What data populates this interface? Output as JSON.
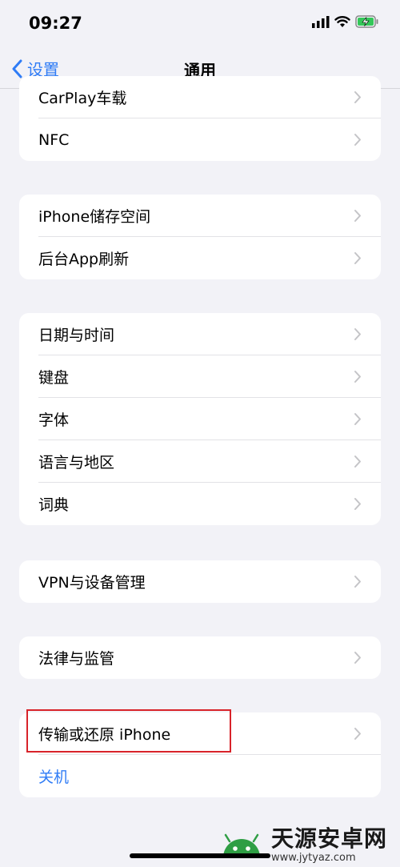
{
  "status": {
    "time": "09:27"
  },
  "nav": {
    "back_label": "设置",
    "title": "通用"
  },
  "groups": [
    {
      "items": [
        {
          "label": "CarPlay车载"
        },
        {
          "label": "NFC"
        }
      ]
    },
    {
      "items": [
        {
          "label": "iPhone储存空间"
        },
        {
          "label": "后台App刷新"
        }
      ]
    },
    {
      "items": [
        {
          "label": "日期与时间"
        },
        {
          "label": "键盘"
        },
        {
          "label": "字体"
        },
        {
          "label": "语言与地区"
        },
        {
          "label": "词典"
        }
      ]
    },
    {
      "items": [
        {
          "label": "VPN与设备管理"
        }
      ]
    },
    {
      "items": [
        {
          "label": "法律与监管"
        }
      ]
    },
    {
      "items": [
        {
          "label": "传输或还原 iPhone"
        },
        {
          "label": "关机"
        }
      ]
    }
  ],
  "watermark": {
    "title": "天源安卓网",
    "url": "www.jytyaz.com"
  },
  "colors": {
    "accent": "#2f7cf6",
    "highlight": "#d8232a",
    "background": "#f2f2f7",
    "battery": "#34c759"
  }
}
